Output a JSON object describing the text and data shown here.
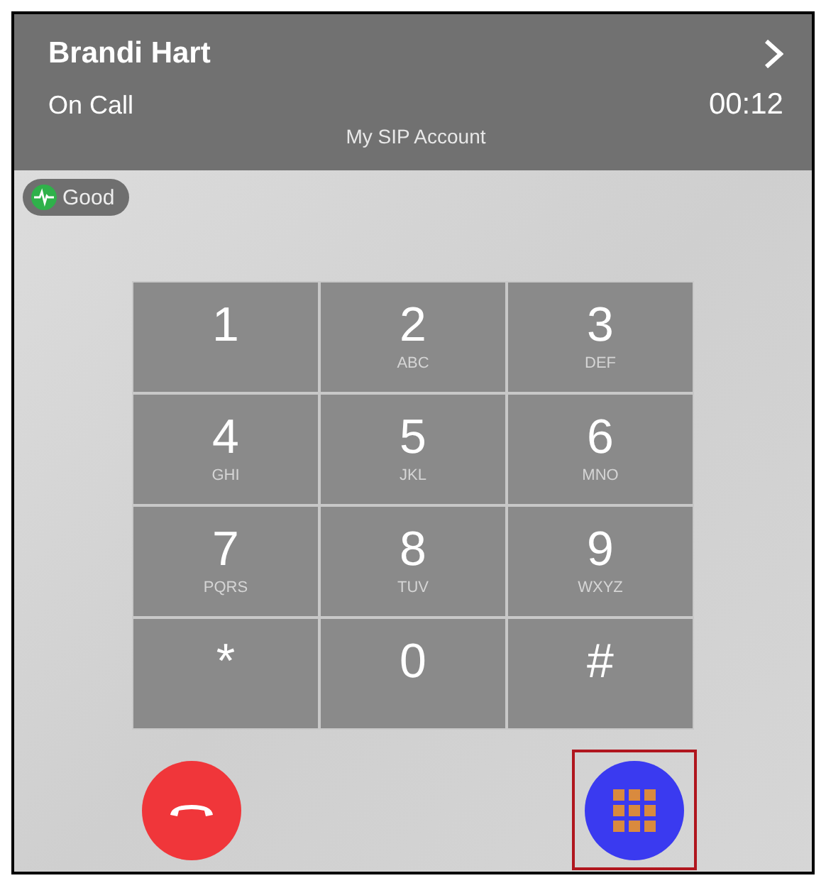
{
  "header": {
    "name": "Brandi Hart",
    "status": "On Call",
    "timer": "00:12",
    "account": "My SIP Account"
  },
  "quality": {
    "label": "Good"
  },
  "keypad": [
    {
      "digit": "1"
    },
    {
      "digit": "2",
      "letters": "ABC"
    },
    {
      "digit": "3",
      "letters": "DEF"
    },
    {
      "digit": "4",
      "letters": "GHI"
    },
    {
      "digit": "5",
      "letters": "JKL"
    },
    {
      "digit": "6",
      "letters": "MNO"
    },
    {
      "digit": "7",
      "letters": "PQRS"
    },
    {
      "digit": "8",
      "letters": "TUV"
    },
    {
      "digit": "9",
      "letters": "WXYZ"
    },
    {
      "digit": "*"
    },
    {
      "digit": "0"
    },
    {
      "digit": "#"
    }
  ],
  "actions": [
    {
      "kind": "hangup",
      "highlighted": false
    },
    {
      "kind": "keypad",
      "highlighted": true
    }
  ]
}
